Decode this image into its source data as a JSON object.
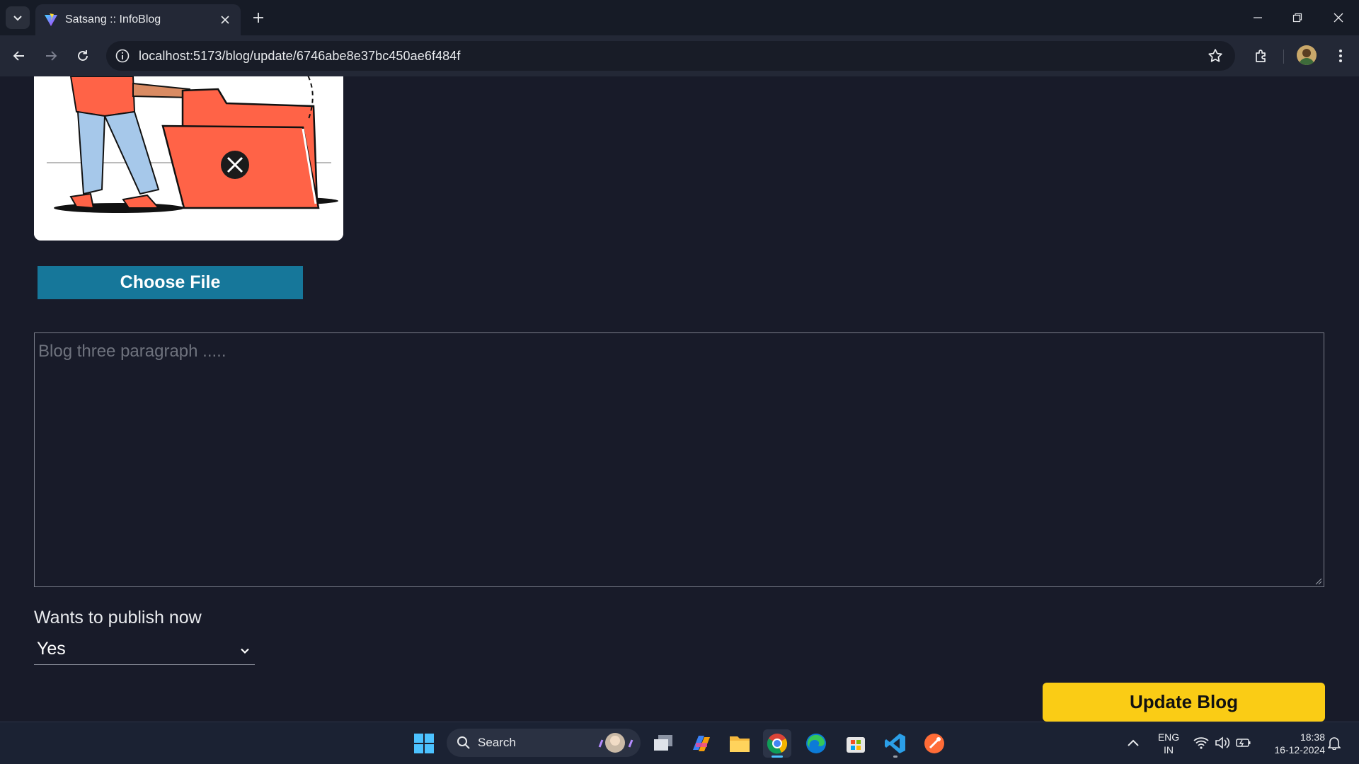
{
  "browser": {
    "tab_title": "Satsang :: InfoBlog",
    "url": "localhost:5173/blog/update/6746abe8e37bc450ae6f484f"
  },
  "form": {
    "choose_file_label": "Choose File",
    "paragraph_placeholder": "Blog three paragraph .....",
    "paragraph_value": "",
    "publish_label": "Wants to publish now",
    "publish_selected": "Yes",
    "update_button_label": "Update Blog"
  },
  "taskbar": {
    "search_label": "Search",
    "language_line1": "ENG",
    "language_line2": "IN",
    "time": "18:38",
    "date": "16-12-2024"
  },
  "colors": {
    "page_bg": "#181b29",
    "choose_file_bg": "#16779a",
    "update_button_bg": "#facc15",
    "illustration_folder": "#ff6347"
  }
}
